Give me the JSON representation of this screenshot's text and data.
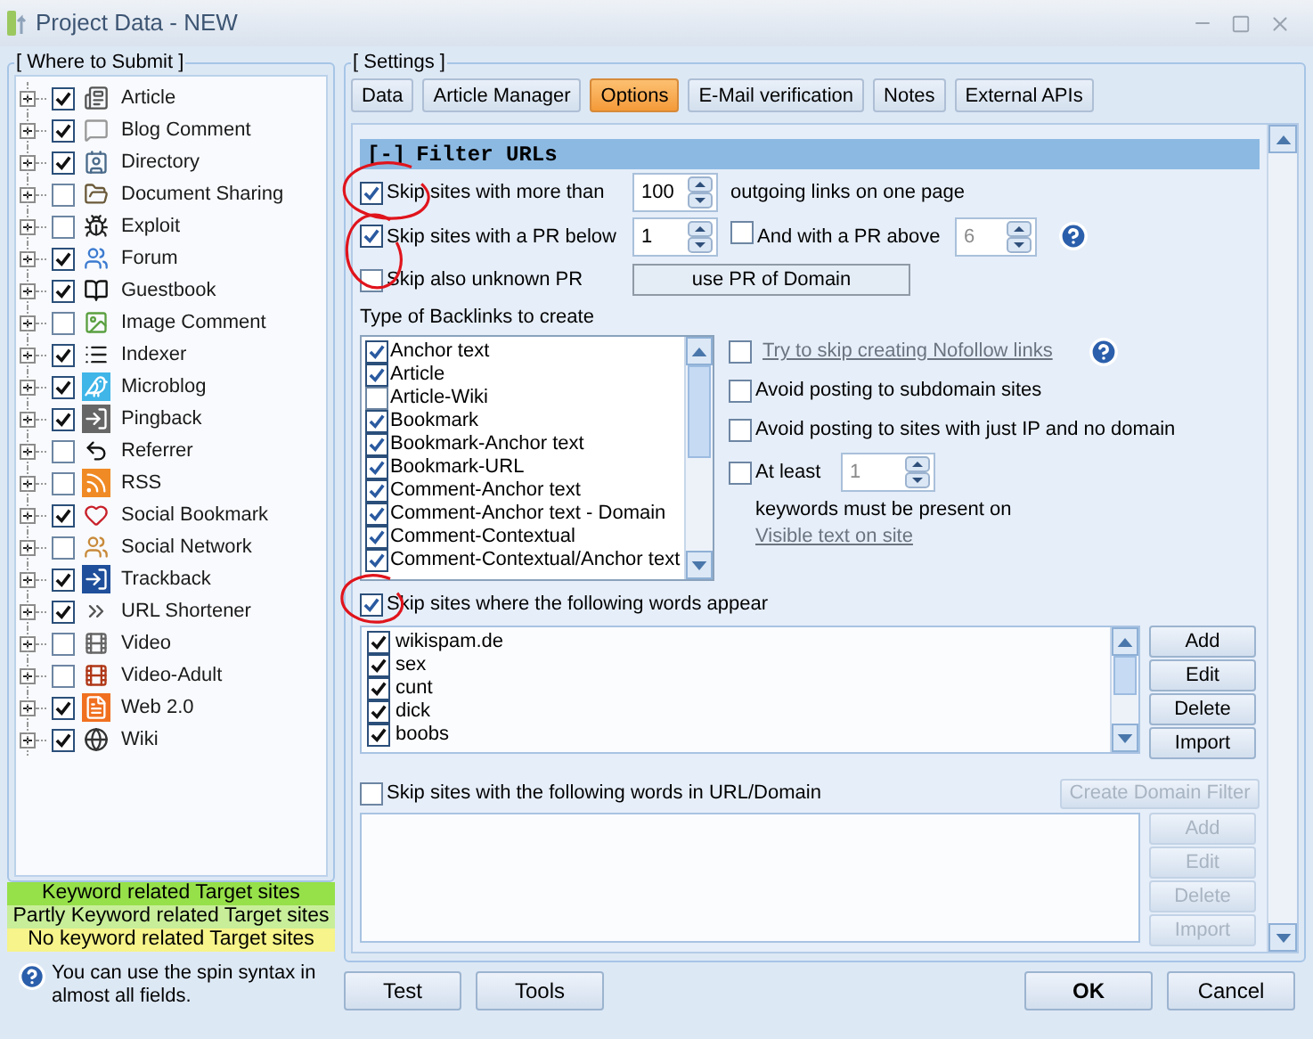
{
  "window": {
    "title": "Project Data - NEW"
  },
  "submit_panel": {
    "title": "[ Where to Submit ]",
    "items": [
      {
        "label": "Article",
        "checked": true
      },
      {
        "label": "Blog Comment",
        "checked": true
      },
      {
        "label": "Directory",
        "checked": true
      },
      {
        "label": "Document Sharing",
        "checked": false
      },
      {
        "label": "Exploit",
        "checked": false
      },
      {
        "label": "Forum",
        "checked": true
      },
      {
        "label": "Guestbook",
        "checked": true
      },
      {
        "label": "Image Comment",
        "checked": false
      },
      {
        "label": "Indexer",
        "checked": true
      },
      {
        "label": "Microblog",
        "checked": true
      },
      {
        "label": "Pingback",
        "checked": true
      },
      {
        "label": "Referrer",
        "checked": false
      },
      {
        "label": "RSS",
        "checked": false
      },
      {
        "label": "Social Bookmark",
        "checked": true
      },
      {
        "label": "Social Network",
        "checked": false
      },
      {
        "label": "Trackback",
        "checked": true
      },
      {
        "label": "URL Shortener",
        "checked": true
      },
      {
        "label": "Video",
        "checked": false
      },
      {
        "label": "Video-Adult",
        "checked": false
      },
      {
        "label": "Web 2.0",
        "checked": true
      },
      {
        "label": "Wiki",
        "checked": true
      }
    ]
  },
  "legend": [
    {
      "label": "Keyword related Target sites",
      "color": "#96e04a"
    },
    {
      "label": "Partly Keyword related Target sites",
      "color": "#c8ee9a"
    },
    {
      "label": "No keyword related Target sites",
      "color": "#f6f48a"
    }
  ],
  "hint": "You can use the spin syntax in almost all fields.",
  "settings": {
    "title": "[ Settings ]",
    "tabs": [
      {
        "label": "Data",
        "selected": false
      },
      {
        "label": "Article Manager",
        "selected": false
      },
      {
        "label": "Options",
        "selected": true
      },
      {
        "label": "E-Mail verification",
        "selected": false
      },
      {
        "label": "Notes",
        "selected": false
      },
      {
        "label": "External APIs",
        "selected": false
      }
    ],
    "section": {
      "toggle": "[-]",
      "title": "Filter URLs"
    },
    "max_links": {
      "label": "Skip sites with more than",
      "checked": true,
      "value": "100",
      "suffix": "outgoing links on one page"
    },
    "pr_below": {
      "label": "Skip sites with a PR below",
      "checked": true,
      "value": "1"
    },
    "pr_above": {
      "label": "And with a PR above",
      "checked": false,
      "value": "6"
    },
    "unknown_pr": {
      "label": "Skip also unknown PR",
      "checked": false
    },
    "domain_pr_button": "use PR of Domain",
    "backlink_types": {
      "label": "Type of Backlinks to create",
      "items": [
        {
          "label": "Anchor text",
          "checked": true
        },
        {
          "label": "Article",
          "checked": true
        },
        {
          "label": "Article-Wiki",
          "checked": false
        },
        {
          "label": "Bookmark",
          "checked": true
        },
        {
          "label": "Bookmark-Anchor text",
          "checked": true
        },
        {
          "label": "Bookmark-URL",
          "checked": true
        },
        {
          "label": "Comment-Anchor text",
          "checked": true
        },
        {
          "label": "Comment-Anchor text - Domain",
          "checked": true
        },
        {
          "label": "Comment-Contextual",
          "checked": true
        },
        {
          "label": "Comment-Contextual/Anchor text",
          "checked": true
        }
      ]
    },
    "nofollow": {
      "label": "Try to skip creating Nofollow links",
      "checked": false
    },
    "subdomain": {
      "label": "Avoid posting to subdomain sites",
      "checked": false
    },
    "ip_only": {
      "label": "Avoid posting to sites with just IP and no domain",
      "checked": false
    },
    "at_least": {
      "label": "At least",
      "checked": false,
      "value": "1",
      "note": "keywords must be present on",
      "link": "Visible text on site"
    },
    "bad_words": {
      "label": "Skip sites where the following words appear",
      "checked": true,
      "items": [
        {
          "label": "wikispam.de",
          "checked": true
        },
        {
          "label": "sex",
          "checked": true
        },
        {
          "label": "cunt",
          "checked": true
        },
        {
          "label": "dick",
          "checked": true
        },
        {
          "label": "boobs",
          "checked": true
        }
      ],
      "buttons": [
        {
          "label": "Add",
          "disabled": false
        },
        {
          "label": "Edit",
          "disabled": false
        },
        {
          "label": "Delete",
          "disabled": false
        },
        {
          "label": "Import",
          "disabled": false
        }
      ]
    },
    "url_words": {
      "label": "Skip sites with the following words in URL/Domain",
      "checked": false,
      "create_button": {
        "label": "Create Domain Filter",
        "disabled": true
      },
      "buttons": [
        {
          "label": "Add",
          "disabled": true
        },
        {
          "label": "Edit",
          "disabled": true
        },
        {
          "label": "Delete",
          "disabled": true
        },
        {
          "label": "Import",
          "disabled": true
        }
      ]
    }
  },
  "footer": {
    "left": [
      {
        "label": "Test",
        "default": false
      },
      {
        "label": "Tools",
        "default": false
      }
    ],
    "right": [
      {
        "label": "OK",
        "default": true
      },
      {
        "label": "Cancel",
        "default": false
      }
    ]
  }
}
